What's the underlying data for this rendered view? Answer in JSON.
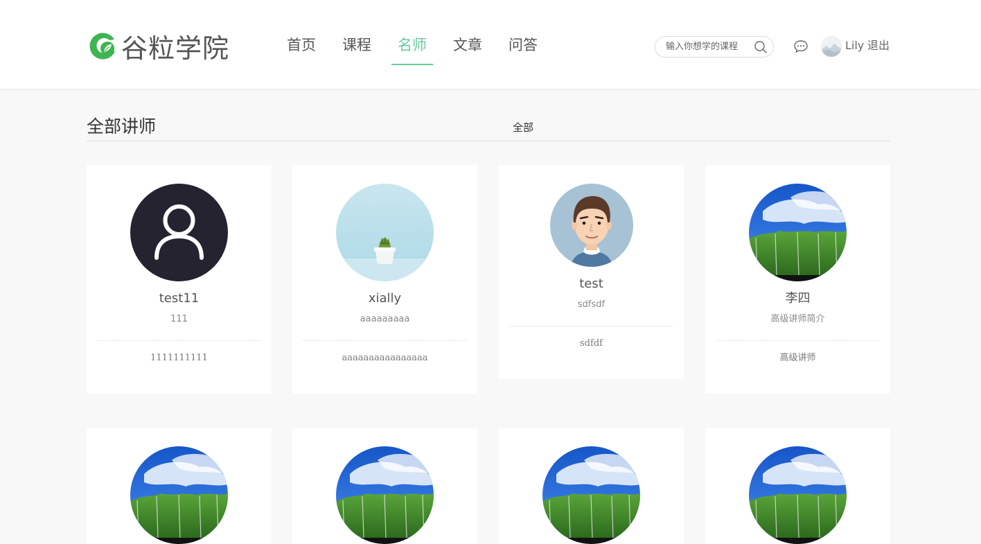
{
  "brand": {
    "name": "谷粒学院",
    "accent": "#68cb9b"
  },
  "nav": [
    {
      "label": "首页",
      "active": false
    },
    {
      "label": "课程",
      "active": false
    },
    {
      "label": "名师",
      "active": true
    },
    {
      "label": "文章",
      "active": false
    },
    {
      "label": "问答",
      "active": false
    }
  ],
  "search": {
    "placeholder": "输入你想学的课程",
    "icon": "search-icon"
  },
  "user": {
    "name": "Lily",
    "logout_label": "退出",
    "message_icon": "chat-icon"
  },
  "section": {
    "title": "全部讲师",
    "filter_label": "全部"
  },
  "teachers": [
    {
      "name": "test11",
      "intro": "111",
      "career": "1111111111",
      "avatar": "default-user-icon"
    },
    {
      "name": "xially",
      "intro": "aaaaaaaaa",
      "career": "aaaaaaaaaaaaaaaa",
      "avatar": "plant-photo"
    },
    {
      "name": "test",
      "intro": "sdfsdf",
      "career": "sdfdf",
      "avatar": "cartoon-man"
    },
    {
      "name": "李四",
      "intro": "高级讲师简介",
      "career": "高级讲师",
      "avatar": "forest-photo"
    },
    {
      "avatar": "forest-photo"
    },
    {
      "avatar": "forest-photo"
    },
    {
      "avatar": "forest-photo"
    },
    {
      "avatar": "forest-photo"
    }
  ]
}
